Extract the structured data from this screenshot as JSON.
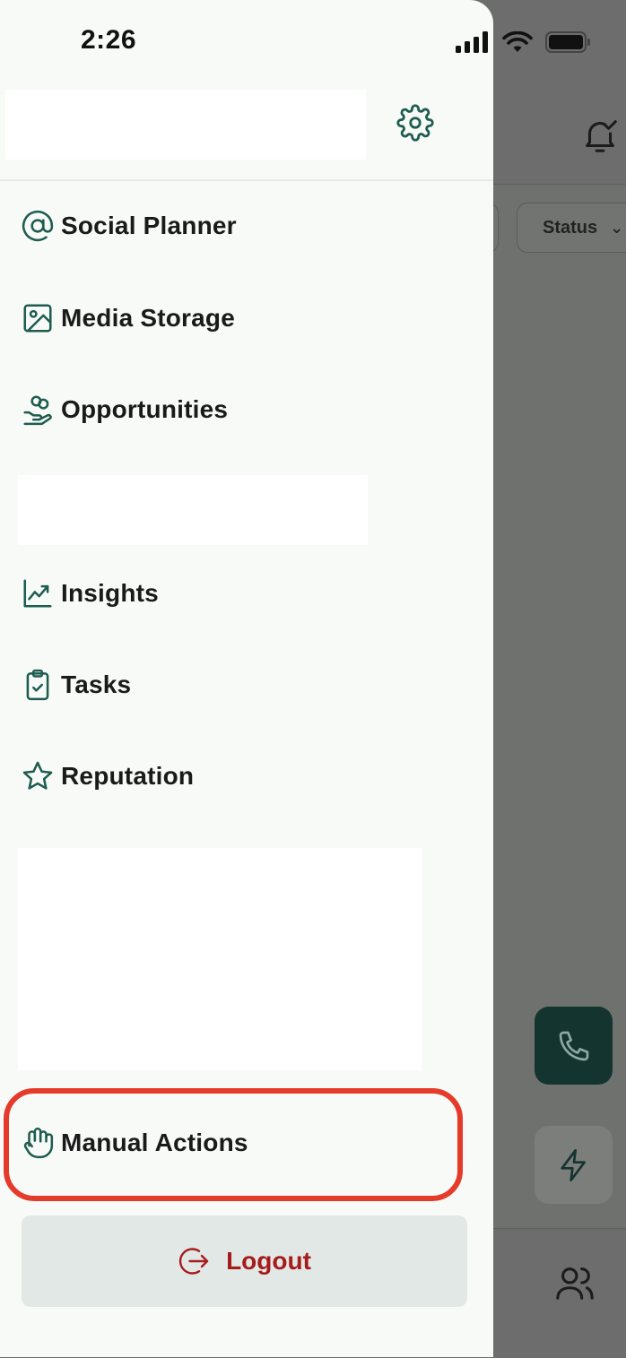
{
  "status_bar": {
    "time": "2:26"
  },
  "background": {
    "filter_status_label": "Status"
  },
  "drawer": {
    "menu": [
      {
        "label": "Social Planner",
        "icon": "at-sign-icon"
      },
      {
        "label": "Media Storage",
        "icon": "image-icon"
      },
      {
        "label": "Opportunities",
        "icon": "hand-coins-icon"
      },
      {
        "label": "Insights",
        "icon": "trend-chart-icon"
      },
      {
        "label": "Tasks",
        "icon": "clipboard-check-icon"
      },
      {
        "label": "Reputation",
        "icon": "star-icon"
      },
      {
        "label": "Manual Actions",
        "icon": "hand-icon"
      }
    ],
    "logout_label": "Logout"
  },
  "colors": {
    "accent": "#1e5c4f",
    "highlight": "#e53b2a",
    "logout_text": "#a61c1c",
    "fab_dark": "#14342f"
  }
}
